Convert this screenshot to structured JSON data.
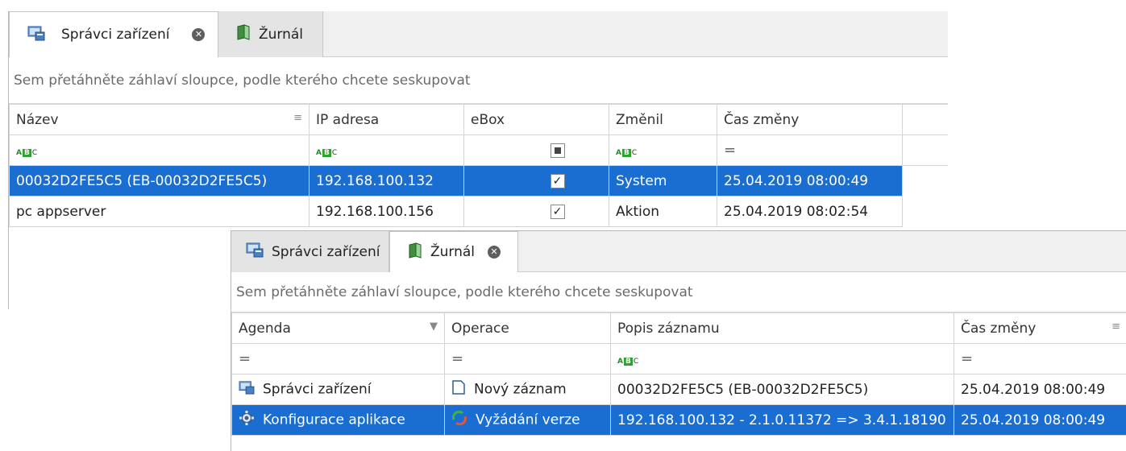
{
  "devices_window": {
    "tabs": [
      {
        "label": "Správci zařízení",
        "icon": "device-managers-icon",
        "active": true,
        "closable": true
      },
      {
        "label": "Žurnál",
        "icon": "journal-book-icon",
        "active": false
      }
    ],
    "group_panel_text": "Sem přetáhněte záhlaví sloupce, podle kterého chcete seskupovat",
    "columns": [
      "Název",
      "IP adresa",
      "eBox",
      "Změnil",
      "Čas změny"
    ],
    "filter_row": [
      "abc",
      "abc",
      "checkbox-indeterminate",
      "abc",
      "="
    ],
    "rows": [
      {
        "name": "00032D2FE5C5 (EB-00032D2FE5C5)",
        "ip": "192.168.100.132",
        "ebox": true,
        "changed_by": "System",
        "time": "25.04.2019 08:00:49",
        "selected": true
      },
      {
        "name": "pc appserver",
        "ip": "192.168.100.156",
        "ebox": true,
        "changed_by": "Aktion",
        "time": "25.04.2019 08:02:54",
        "selected": false
      }
    ]
  },
  "journal_window": {
    "tabs": [
      {
        "label": "Správci zařízení",
        "icon": "device-managers-icon",
        "active": false
      },
      {
        "label": "Žurnál",
        "icon": "journal-book-icon",
        "active": true,
        "closable": true
      }
    ],
    "group_panel_text": "Sem přetáhněte záhlaví sloupce, podle kterého chcete seskupovat",
    "columns": [
      "Agenda",
      "Operace",
      "Popis záznamu",
      "Čas změny"
    ],
    "filter_row": [
      "=",
      "=",
      "abc",
      "="
    ],
    "rows": [
      {
        "agenda": "Správci zařízení",
        "agenda_icon": "device-managers-icon",
        "operation": "Nový záznam",
        "operation_icon": "new-record-icon",
        "description": "00032D2FE5C5 (EB-00032D2FE5C5)",
        "time": "25.04.2019 08:00:49",
        "selected": false
      },
      {
        "agenda": "Konfigurace aplikace",
        "agenda_icon": "gear-icon",
        "operation": "Vyžádání verze",
        "operation_icon": "version-request-icon",
        "description": "192.168.100.132 - 2.1.0.11372 => 3.4.1.18190",
        "time": "25.04.2019 08:00:49",
        "selected": true
      }
    ]
  },
  "colors": {
    "selection": "#1b6ed1",
    "tab_bar": "#f0f0f0",
    "grid_line": "#d4d4d4"
  }
}
